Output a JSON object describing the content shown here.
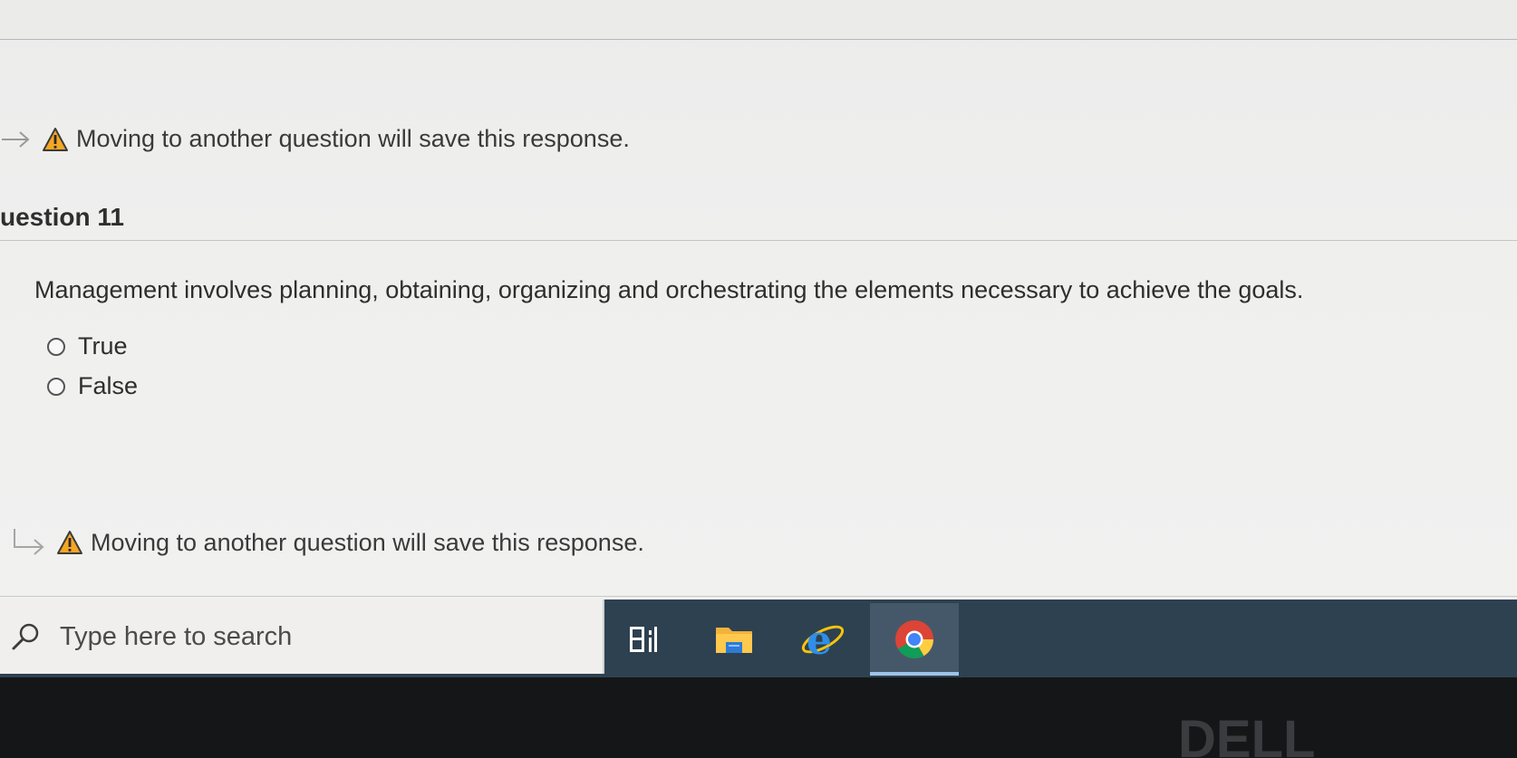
{
  "notice": {
    "top_text": "Moving to another question will save this response.",
    "bottom_text": "Moving to another question will save this response."
  },
  "question": {
    "title": "uestion 11",
    "text": "Management involves planning, obtaining, organizing and orchestrating the elements necessary to achieve the goals.",
    "options": [
      {
        "label": "True"
      },
      {
        "label": "False"
      }
    ]
  },
  "taskbar": {
    "search_placeholder": "Type here to search",
    "apps": [
      "task-view-icon",
      "file-explorer-icon",
      "internet-explorer-icon",
      "chrome-icon"
    ],
    "active_app": "chrome-icon"
  },
  "brand": {
    "logo": "DELL"
  },
  "colors": {
    "warning": "#f5a623",
    "taskbar": "#2e4150",
    "active_indicator": "#9ec3e8"
  }
}
